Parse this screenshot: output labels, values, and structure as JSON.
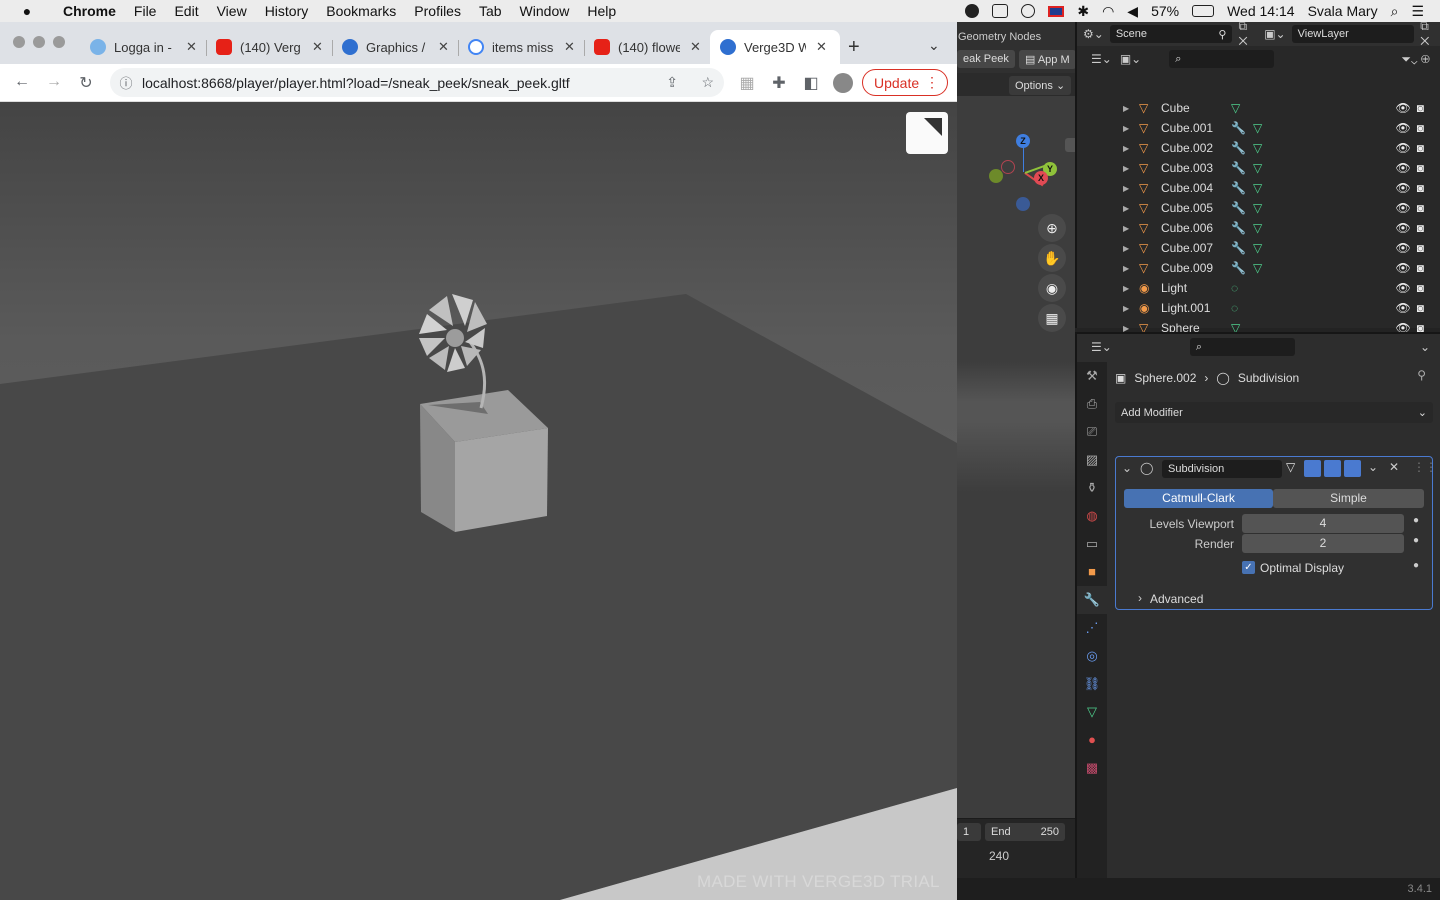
{
  "menubar": {
    "items": [
      "Chrome",
      "File",
      "Edit",
      "View",
      "History",
      "Bookmarks",
      "Profiles",
      "Tab",
      "Window",
      "Help"
    ],
    "battery": "57%",
    "clock": "Wed 14:14",
    "user": "Svala Mary"
  },
  "browser": {
    "tabs": [
      {
        "title": "Logga in -",
        "icon": "web-app-icon"
      },
      {
        "title": "(140) Verg",
        "icon": "youtube-icon"
      },
      {
        "title": "Graphics /",
        "icon": "verge3d-icon"
      },
      {
        "title": "items miss",
        "icon": "google-icon"
      },
      {
        "title": "(140) flowe",
        "icon": "youtube-icon"
      },
      {
        "title": "Verge3D W",
        "icon": "verge3d-icon",
        "active": true
      }
    ],
    "url": "localhost:8668/player/player.html?load=/sneak_peek/sneak_peek.gltf",
    "update_label": "Update"
  },
  "viewer": {
    "watermark": "MADE WITH VERGE3D TRIAL"
  },
  "blender": {
    "viewport_header": "Geometry Nodes",
    "workspace_tabs": [
      "eak Peek",
      "App M"
    ],
    "options_label": "Options",
    "scene_label": "Scene",
    "viewlayer_label": "ViewLayer",
    "gizmo": {
      "z": "Z",
      "y": "Y",
      "x": "X"
    },
    "outliner_rows": [
      {
        "name": "Cube",
        "type": "mesh",
        "has_modifier": false
      },
      {
        "name": "Cube.001",
        "type": "mesh",
        "has_modifier": true
      },
      {
        "name": "Cube.002",
        "type": "mesh",
        "has_modifier": true
      },
      {
        "name": "Cube.003",
        "type": "mesh",
        "has_modifier": true
      },
      {
        "name": "Cube.004",
        "type": "mesh",
        "has_modifier": true
      },
      {
        "name": "Cube.005",
        "type": "mesh",
        "has_modifier": true
      },
      {
        "name": "Cube.006",
        "type": "mesh",
        "has_modifier": true
      },
      {
        "name": "Cube.007",
        "type": "mesh",
        "has_modifier": true
      },
      {
        "name": "Cube.009",
        "type": "mesh",
        "has_modifier": true
      },
      {
        "name": "Light",
        "type": "light",
        "has_modifier": false
      },
      {
        "name": "Light.001",
        "type": "light",
        "has_modifier": false
      },
      {
        "name": "Sphere",
        "type": "mesh",
        "has_modifier": false
      }
    ],
    "properties": {
      "object": "Sphere.002",
      "modifier_breadcrumb": "Subdivision",
      "add_modifier": "Add Modifier",
      "modifier_name": "Subdivision",
      "mode_catmull": "Catmull-Clark",
      "mode_simple": "Simple",
      "levels_viewport_label": "Levels Viewport",
      "levels_viewport_value": "4",
      "render_label": "Render",
      "render_value": "2",
      "optimal_display_label": "Optimal Display",
      "optimal_display_checked": true,
      "advanced_label": "Advanced"
    },
    "timeline": {
      "start": "1",
      "end_label": "End",
      "end_value": "250",
      "current": "240"
    },
    "version": "3.4.1"
  }
}
